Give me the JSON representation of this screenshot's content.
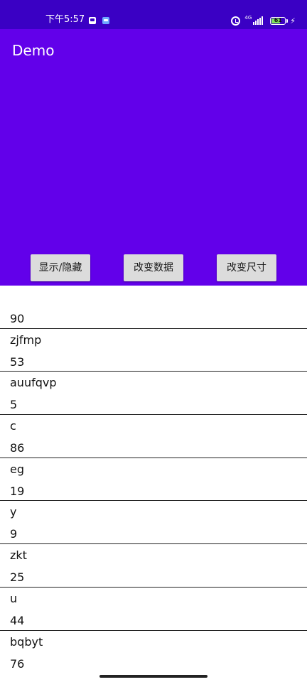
{
  "status_bar": {
    "time": "下午5:57",
    "network": "4G",
    "battery": "61"
  },
  "app": {
    "title": "Demo"
  },
  "buttons": [
    {
      "label": "显示/隐藏"
    },
    {
      "label": "改变数据"
    },
    {
      "label": "改变尺寸"
    }
  ],
  "list": [
    {
      "title": "",
      "value": "90"
    },
    {
      "title": "zjfmp",
      "value": "53"
    },
    {
      "title": "auufqvp",
      "value": "5"
    },
    {
      "title": "c",
      "value": "86"
    },
    {
      "title": "eg",
      "value": "19"
    },
    {
      "title": "y",
      "value": "9"
    },
    {
      "title": "zkt",
      "value": "25"
    },
    {
      "title": "u",
      "value": "44"
    },
    {
      "title": "bqbyt",
      "value": "76"
    }
  ],
  "colors": {
    "status_bar": "#3a00c4",
    "primary": "#6200ea",
    "button": "#dcdcdc"
  },
  "icons": [
    "alarm-icon",
    "signal-icon",
    "battery-icon",
    "charging-icon"
  ]
}
